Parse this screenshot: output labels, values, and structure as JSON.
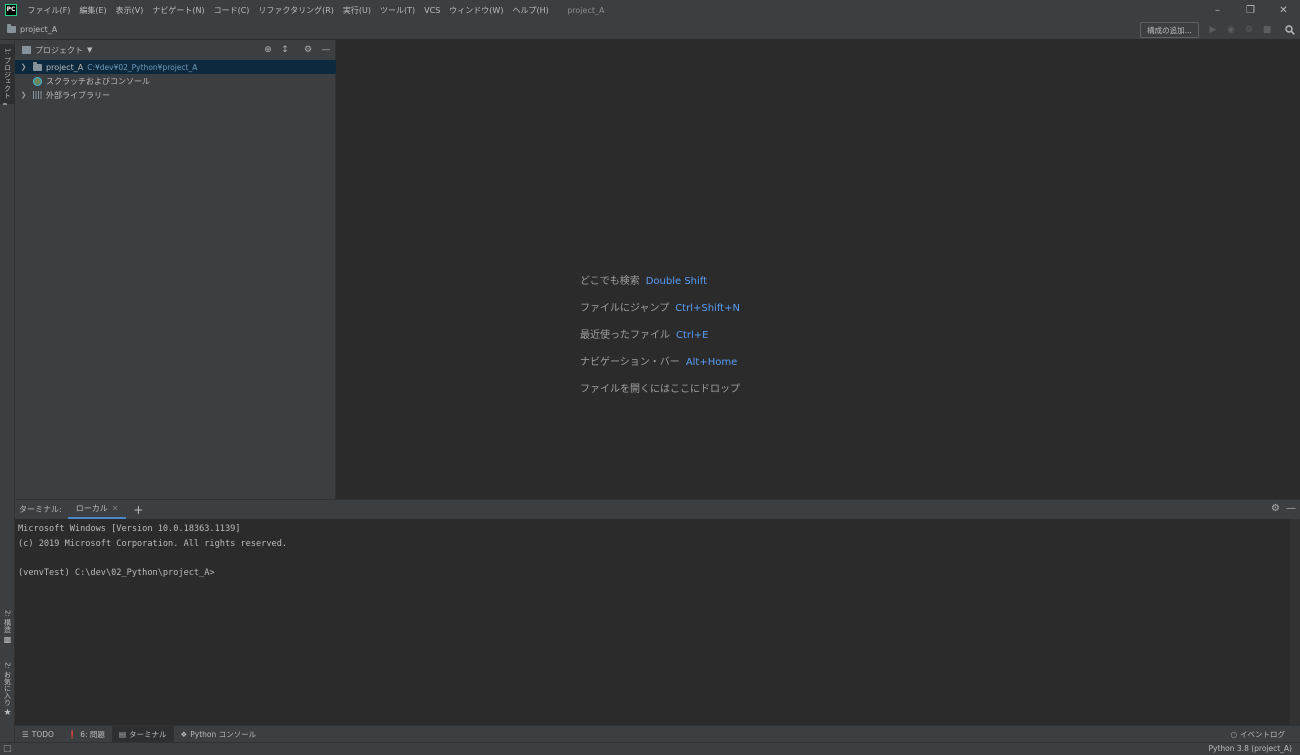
{
  "menu": {
    "items": [
      "ファイル(F)",
      "編集(E)",
      "表示(V)",
      "ナビゲート(N)",
      "コード(C)",
      "リファクタリング(R)",
      "実行(U)",
      "ツール(T)",
      "VCS",
      "ウィンドウ(W)",
      "ヘルプ(H)"
    ],
    "window_title": "project_A"
  },
  "navbar": {
    "breadcrumb": "project_A",
    "add_config_label": "構成の追加..."
  },
  "left_stripe": {
    "project_label": "1: プロジェクト",
    "structure_label": "2: 構造",
    "favorites_label": "2: お気に入り"
  },
  "project_panel": {
    "title": "プロジェクト",
    "tree": [
      {
        "name": "project_A",
        "path": "C:¥dev¥02_Python¥project_A"
      },
      {
        "name": "スクラッチおよびコンソール"
      },
      {
        "name": "外部ライブラリー"
      }
    ]
  },
  "editor": {
    "hints": [
      {
        "text": "どこでも検索",
        "key": "Double Shift"
      },
      {
        "text": "ファイルにジャンプ",
        "key": "Ctrl+Shift+N"
      },
      {
        "text": "最近使ったファイル",
        "key": "Ctrl+E"
      },
      {
        "text": "ナビゲーション・バー",
        "key": "Alt+Home"
      },
      {
        "text": "ファイルを開くにはここにドロップ",
        "key": ""
      }
    ]
  },
  "terminal": {
    "title": "ターミナル:",
    "tab_label": "ローカル",
    "lines": [
      "Microsoft Windows [Version 10.0.18363.1139]",
      "(c) 2019 Microsoft Corporation. All rights reserved.",
      "",
      "(venvTest) C:\\dev\\02_Python\\project_A>"
    ]
  },
  "bottom_tools": {
    "todo": "TODO",
    "problems": "6: 問題",
    "terminal": "ターミナル",
    "python_console": "Python コンソール",
    "event_log": "イベントログ"
  },
  "status": {
    "interpreter": "Python 3.8 (project_A)"
  }
}
